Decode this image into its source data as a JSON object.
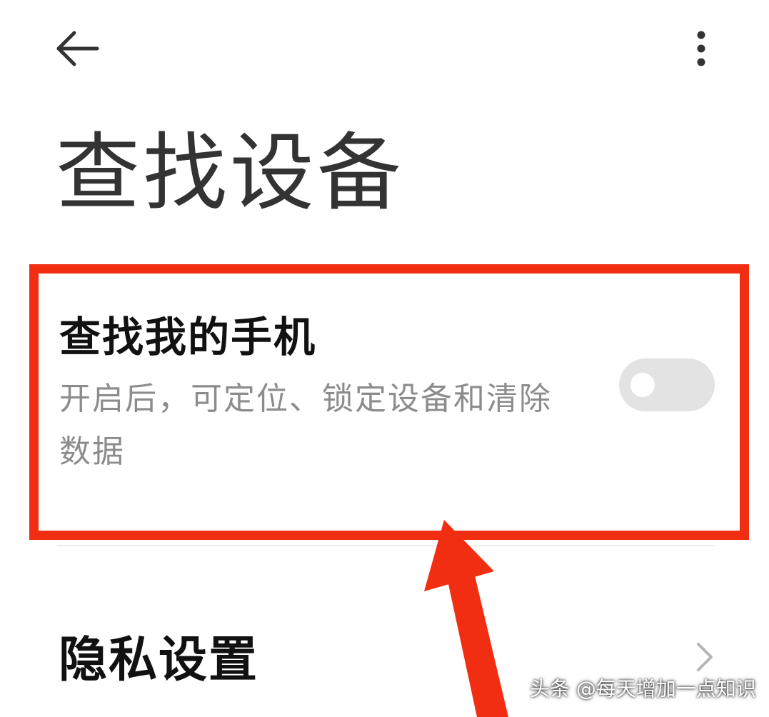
{
  "header": {
    "back_icon": "arrow-left-icon",
    "more_icon": "more-vertical-icon",
    "title": "查找设备"
  },
  "find_my_phone": {
    "title": "查找我的手机",
    "description": "开启后，可定位、锁定设备和清除数据",
    "toggle_state": "off"
  },
  "privacy_settings": {
    "label": "隐私设置",
    "chevron_icon": "chevron-right-icon"
  },
  "annotation": {
    "highlight_color": "#f22e12",
    "pointer": "red-arrow"
  },
  "watermark": {
    "text": "头条 @每天增加一点知识"
  }
}
